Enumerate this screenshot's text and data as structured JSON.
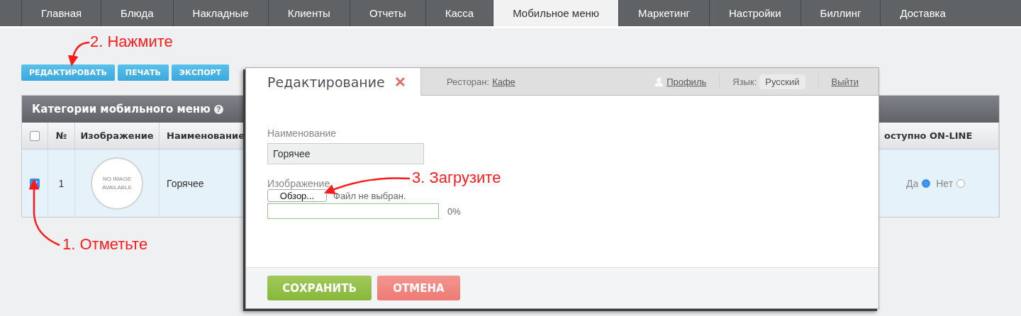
{
  "nav_tabs": [
    {
      "label": "Главная",
      "selected": false
    },
    {
      "label": "Блюда",
      "selected": false
    },
    {
      "label": "Накладные",
      "selected": false
    },
    {
      "label": "Клиенты",
      "selected": false
    },
    {
      "label": "Отчеты",
      "selected": false
    },
    {
      "label": "Касса",
      "selected": false
    },
    {
      "label": "Мобильное меню",
      "selected": true
    },
    {
      "label": "Маркетинг",
      "selected": false
    },
    {
      "label": "Настройки",
      "selected": false
    },
    {
      "label": "Биллинг",
      "selected": false
    },
    {
      "label": "Доставка",
      "selected": false
    }
  ],
  "toolbar": [
    "РЕДАКТИРОВАТЬ",
    "ПЕЧАТЬ",
    "ЭКСПОРТ"
  ],
  "panel": {
    "title": "Категории мобильного меню",
    "help_icon": "?",
    "select_all": {
      "checked": false
    },
    "columns": [
      "№",
      "Изображение",
      "Наименование",
      "оступно ON-LINE"
    ],
    "rows": [
      {
        "selected": true,
        "checked": true,
        "number": "1",
        "image_text": "NO IMAGE AVAILABLE",
        "name": "Горячее",
        "online": [
          {
            "label": "Да",
            "selected": true
          },
          {
            "label": "Нет",
            "selected": false
          }
        ]
      }
    ]
  },
  "modal": {
    "title": "Редактирование",
    "restaurant_label": "Ресторан:",
    "restaurant": "Кафе",
    "profile": "Профиль",
    "language_label": "Язык:",
    "language": "Русский",
    "logout": "Выйти",
    "name_label": "Наименование",
    "name_value": "Горячее",
    "image_label": "Изображение",
    "browse_button": "Обзор...",
    "file_status": "Файл не выбран.",
    "upload": {
      "level": 0
    },
    "upload_text": "0%",
    "buttons": [
      {
        "label": "СОХРАНИТЬ",
        "kind": "save"
      },
      {
        "label": "ОТМЕНА",
        "kind": "cancel"
      }
    ]
  },
  "annotations": [
    {
      "text": "2. Нажмите"
    },
    {
      "text": "1. Отметьте"
    },
    {
      "text": "3. Загрузите"
    }
  ]
}
